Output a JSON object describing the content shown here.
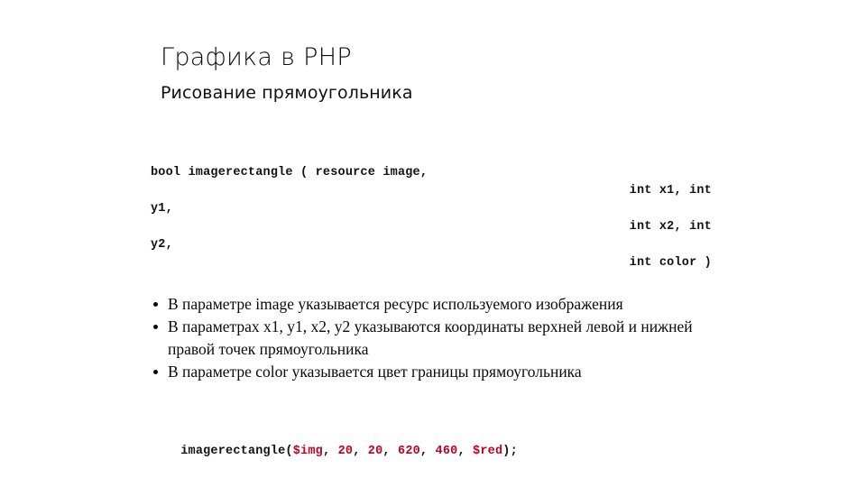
{
  "slide": {
    "title": "Графика в PHP",
    "subtitle": "Рисование прямоугольника"
  },
  "signature": {
    "lines": [
      {
        "text": "bool imagerectangle ( resource image,",
        "align": "left"
      },
      {
        "text": "int x1, int",
        "align": "right"
      },
      {
        "text": "y1,",
        "align": "left"
      },
      {
        "text": "int x2, int",
        "align": "right"
      },
      {
        "text": "y2,",
        "align": "left"
      },
      {
        "text": "int color )",
        "align": "right"
      }
    ]
  },
  "bullets": [
    "В параметре image указывается ресурс используемого изображения",
    "В параметрах x1, y1, x2, y2 указываются координаты верхней левой и нижней правой точек прямоугольника",
    "В параметре color указывается цвет границы прямоугольника"
  ],
  "example": {
    "tokens": [
      {
        "text": "imagerectangle(",
        "color": "plain"
      },
      {
        "text": "$img",
        "color": "red"
      },
      {
        "text": ", ",
        "color": "plain"
      },
      {
        "text": "20",
        "color": "red"
      },
      {
        "text": ", ",
        "color": "plain"
      },
      {
        "text": "20",
        "color": "red"
      },
      {
        "text": ", ",
        "color": "plain"
      },
      {
        "text": "620",
        "color": "red"
      },
      {
        "text": ", ",
        "color": "plain"
      },
      {
        "text": "460",
        "color": "red"
      },
      {
        "text": ", ",
        "color": "plain"
      },
      {
        "text": "$red",
        "color": "red"
      },
      {
        "text": ");",
        "color": "plain"
      }
    ],
    "full_text": "imagerectangle($img, 20, 20, 620, 460, $red);"
  },
  "colors": {
    "background": "#ffffff",
    "text": "#111111",
    "accent_red": "#c00020"
  }
}
